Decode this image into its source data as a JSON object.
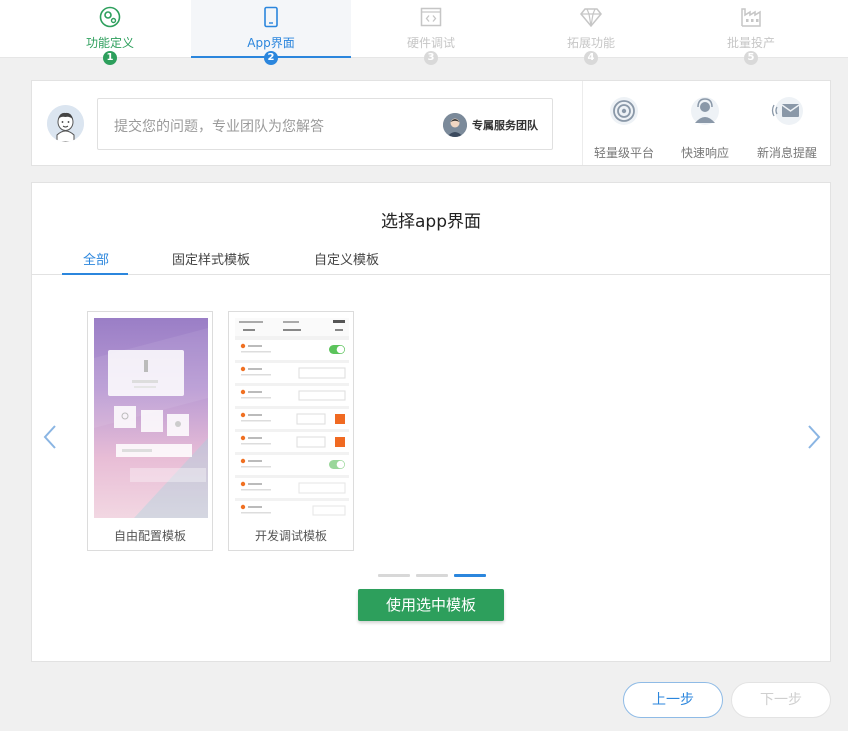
{
  "stepper": {
    "steps": [
      {
        "label": "功能定义",
        "num": "1",
        "state": "done",
        "icon": "gear-circle-icon"
      },
      {
        "label": "App界面",
        "num": "2",
        "state": "active",
        "icon": "phone-icon"
      },
      {
        "label": "硬件调试",
        "num": "3",
        "state": "todo",
        "icon": "code-window-icon"
      },
      {
        "label": "拓展功能",
        "num": "4",
        "state": "todo",
        "icon": "diamond-icon"
      },
      {
        "label": "批量投产",
        "num": "5",
        "state": "todo",
        "icon": "factory-icon"
      }
    ]
  },
  "question": {
    "placeholder": "提交您的问题，专业团队为您解答",
    "team_label": "专属服务团队",
    "features": [
      {
        "label": "轻量级平台",
        "icon": "target-icon"
      },
      {
        "label": "快速响应",
        "icon": "support-agent-icon"
      },
      {
        "label": "新消息提醒",
        "icon": "mail-notify-icon"
      }
    ]
  },
  "main": {
    "title": "选择app界面",
    "tabs": [
      {
        "label": "全部",
        "active": true
      },
      {
        "label": "固定样式模板",
        "active": false
      },
      {
        "label": "自定义模板",
        "active": false
      }
    ],
    "templates": [
      {
        "label": "自由配置模板"
      },
      {
        "label": "开发调试模板"
      }
    ],
    "carousel": {
      "pages": 3,
      "current_page": 3
    },
    "use_button": "使用选中模板"
  },
  "footer": {
    "prev_label": "上一步",
    "next_label": "下一步"
  },
  "colors": {
    "primary_blue": "#2b86dd",
    "success_green": "#2d9f5c",
    "disabled_gray": "#cfcfcf"
  }
}
